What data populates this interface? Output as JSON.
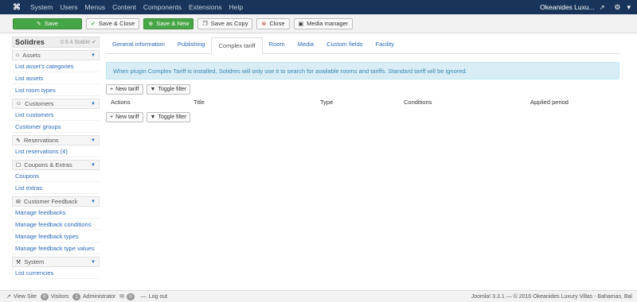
{
  "topnav": {
    "logo": "⌘",
    "menu": [
      "System",
      "Users",
      "Menus",
      "Content",
      "Components",
      "Extensions",
      "Help"
    ],
    "site_name": "Okeanides Luxu...",
    "external_icon": "↗",
    "gear_icon": "⚙",
    "caret": "▾"
  },
  "toolbar": {
    "save": "Save",
    "save_close": "Save & Close",
    "save_new": "Save & New",
    "save_copy": "Save as Copy",
    "close": "Close",
    "media_manager": "Media manager"
  },
  "sidebar": {
    "brand": "Solidres",
    "version": "0.9.4 Stable ✔",
    "groups": [
      {
        "title": "Assets",
        "icon": "⌂",
        "items": [
          "List asset's categories",
          "List assets",
          "List room types"
        ]
      },
      {
        "title": "Customers",
        "icon": "☺",
        "items": [
          "List customers",
          "Customer groups"
        ]
      },
      {
        "title": "Reservations",
        "icon": "✎",
        "items": [
          "List reservations (4)"
        ]
      },
      {
        "title": "Coupons & Extras",
        "icon": "☐",
        "items": [
          "Coupons",
          "List extras"
        ]
      },
      {
        "title": "Customer Feedback",
        "icon": "✉",
        "items": [
          "Manage feedbacks",
          "Manage feedback conditions",
          "Manage feedback types",
          "Manage feedback type values"
        ]
      },
      {
        "title": "System",
        "icon": "⚒",
        "items": [
          "List currencies"
        ]
      }
    ]
  },
  "tabs": [
    "General information",
    "Publishing",
    "Complex tariff",
    "Room",
    "Media",
    "Custom fields",
    "Facility"
  ],
  "active_tab": 2,
  "alert": "When plugin Complex Tariff is installed, Solidres will only use it to search for available rooms and tariffs. Standard tariff will be ignored.",
  "buttons": {
    "new_tariff": "New tariff",
    "toggle_filter": "Toggle filter"
  },
  "table_headers": [
    "Actions",
    "Title",
    "Type",
    "Conditions",
    "Applied period"
  ],
  "status": {
    "view_site": "View Site",
    "visitors_count": "0",
    "visitors": "Visitors",
    "admin_count": "1",
    "administrator": "Administrator",
    "messages_count": "0",
    "logout": "Log out",
    "footer": "Joomla! 3.3.1 — © 2016 Okeanides Luxury Villas - Bahamas, Bal"
  },
  "colors": {
    "nav": "#18345b",
    "link": "#2a69b8",
    "success": "#46a546",
    "danger": "#bd362f",
    "alert_bg": "#d9edf7"
  }
}
